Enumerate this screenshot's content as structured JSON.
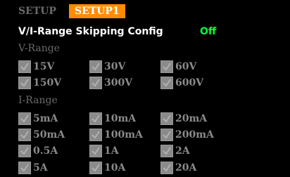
{
  "tabs": [
    {
      "label": "SETUP"
    },
    {
      "label": "SETUP1"
    }
  ],
  "config": {
    "label": "V/I-Range Skipping Config",
    "value": "Off"
  },
  "colors": {
    "accent": "#ff8c00",
    "on_value": "#00ff40",
    "disabled": "#8a8a8a",
    "background": "#000000"
  },
  "v_range": {
    "title": "V-Range",
    "items": [
      {
        "label": "15V",
        "checked": true
      },
      {
        "label": "30V",
        "checked": true
      },
      {
        "label": "60V",
        "checked": true
      },
      {
        "label": "150V",
        "checked": true
      },
      {
        "label": "300V",
        "checked": true
      },
      {
        "label": "600V",
        "checked": true
      }
    ]
  },
  "i_range": {
    "title": "I-Range",
    "items": [
      {
        "label": "5mA",
        "checked": true
      },
      {
        "label": "10mA",
        "checked": true
      },
      {
        "label": "20mA",
        "checked": true
      },
      {
        "label": "50mA",
        "checked": true
      },
      {
        "label": "100mA",
        "checked": true
      },
      {
        "label": "200mA",
        "checked": true
      },
      {
        "label": "0.5A",
        "checked": true
      },
      {
        "label": "1A",
        "checked": true
      },
      {
        "label": "2A",
        "checked": true
      },
      {
        "label": "5A",
        "checked": true
      },
      {
        "label": "10A",
        "checked": true
      },
      {
        "label": "20A",
        "checked": true
      }
    ]
  }
}
